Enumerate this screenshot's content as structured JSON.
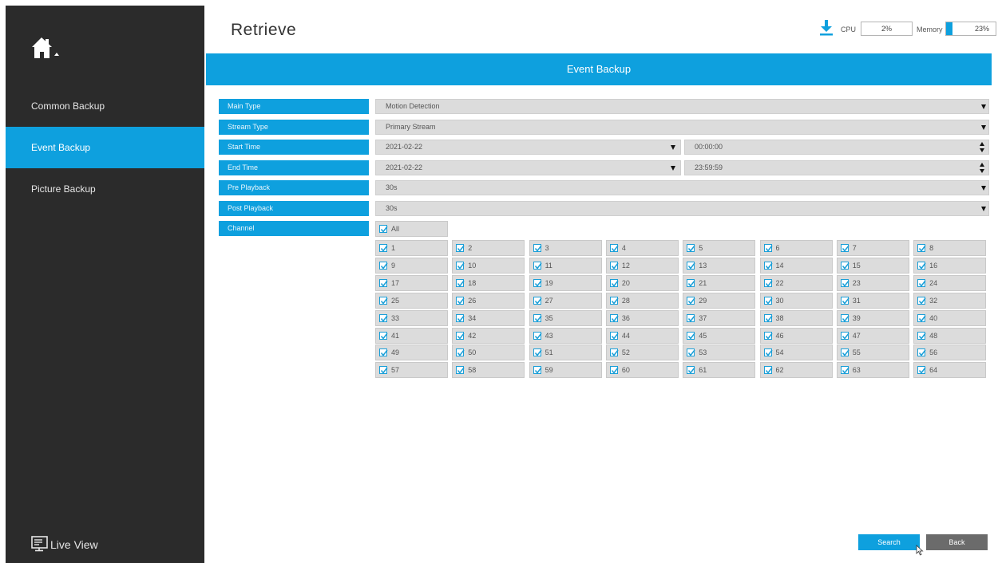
{
  "sidebar": {
    "items": [
      {
        "label": "Common Backup",
        "active": false
      },
      {
        "label": "Event Backup",
        "active": true
      },
      {
        "label": "Picture Backup",
        "active": false
      }
    ],
    "live_view_label": "Live View",
    "home_icon": "home-icon",
    "live_view_icon": "monitor-icon"
  },
  "header": {
    "title": "Retrieve",
    "cpu_label": "CPU",
    "cpu_value": "2%",
    "memory_label": "Memory",
    "memory_value": "23%",
    "memory_fraction": 0.23,
    "download_icon": "download-icon"
  },
  "panel": {
    "title": "Event Backup"
  },
  "form": {
    "main_type": {
      "label": "Main Type",
      "value": "Motion Detection"
    },
    "stream_type": {
      "label": "Stream Type",
      "value": "Primary Stream"
    },
    "start_time": {
      "label": "Start Time",
      "date": "2021-02-22",
      "time": "00:00:00"
    },
    "end_time": {
      "label": "End Time",
      "date": "2021-02-22",
      "time": "23:59:59"
    },
    "pre_playback": {
      "label": "Pre Playback",
      "value": "30s"
    },
    "post_playback": {
      "label": "Post Playback",
      "value": "30s"
    },
    "channel": {
      "label": "Channel",
      "all_label": "All",
      "all_checked": true
    }
  },
  "channels": [
    "1",
    "2",
    "3",
    "4",
    "5",
    "6",
    "7",
    "8",
    "9",
    "10",
    "11",
    "12",
    "13",
    "14",
    "15",
    "16",
    "17",
    "18",
    "19",
    "20",
    "21",
    "22",
    "23",
    "24",
    "25",
    "26",
    "27",
    "28",
    "29",
    "30",
    "31",
    "32",
    "33",
    "34",
    "35",
    "36",
    "37",
    "38",
    "39",
    "40",
    "41",
    "42",
    "43",
    "44",
    "45",
    "46",
    "47",
    "48",
    "49",
    "50",
    "51",
    "52",
    "53",
    "54",
    "55",
    "56",
    "57",
    "58",
    "59",
    "60",
    "61",
    "62",
    "63",
    "64"
  ],
  "buttons": {
    "search": "Search",
    "back": "Back"
  },
  "colors": {
    "accent": "#0ea0de",
    "sidebar_bg": "#2b2b2b",
    "field_bg": "#dcdcdc",
    "back_button": "#6b6b6b"
  }
}
